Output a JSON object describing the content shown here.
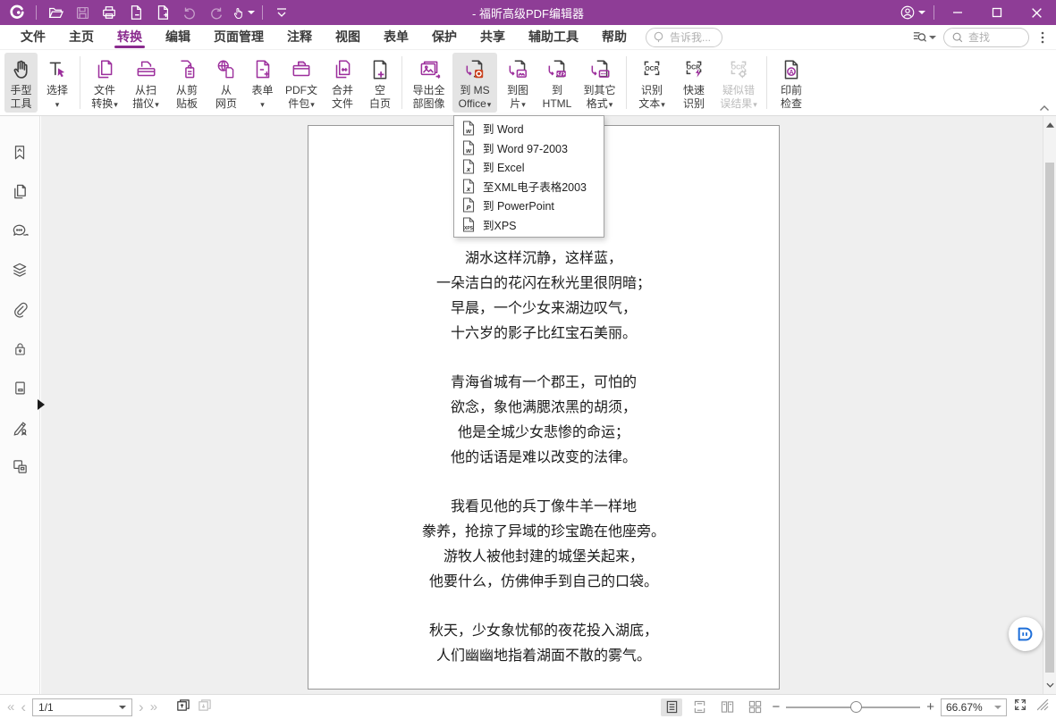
{
  "window": {
    "title": "- 福昕高级PDF编辑器"
  },
  "menu": {
    "tabs": [
      {
        "label": "文件"
      },
      {
        "label": "主页"
      },
      {
        "label": "转换"
      },
      {
        "label": "编辑"
      },
      {
        "label": "页面管理"
      },
      {
        "label": "注释"
      },
      {
        "label": "视图"
      },
      {
        "label": "表单"
      },
      {
        "label": "保护"
      },
      {
        "label": "共享"
      },
      {
        "label": "辅助工具"
      },
      {
        "label": "帮助"
      }
    ],
    "tell_me": "告诉我...",
    "find": "查找"
  },
  "ribbon": {
    "hand_tool": {
      "lines": [
        "手型",
        "工具"
      ]
    },
    "select": {
      "lines": [
        "选择"
      ]
    },
    "file_convert": {
      "lines": [
        "文件",
        "转换"
      ]
    },
    "from_scanner": {
      "lines": [
        "从扫",
        "描仪"
      ]
    },
    "from_clipboard": {
      "lines": [
        "从剪",
        "贴板"
      ]
    },
    "from_web": {
      "lines": [
        "从",
        "网页"
      ]
    },
    "form": {
      "lines": [
        "表单"
      ]
    },
    "pdf_portfolio": {
      "lines": [
        "PDF文",
        "件包"
      ]
    },
    "combine_files": {
      "lines": [
        "合并",
        "文件"
      ]
    },
    "blank_page": {
      "lines": [
        "空",
        "白页"
      ]
    },
    "export_all_images": {
      "lines": [
        "导出全",
        "部图像"
      ]
    },
    "to_ms_office": {
      "lines": [
        "到 MS",
        "Office"
      ]
    },
    "to_image": {
      "lines": [
        "到图",
        "片"
      ]
    },
    "to_html": {
      "lines": [
        "到",
        "HTML"
      ]
    },
    "to_other": {
      "lines": [
        "到其它",
        "格式"
      ]
    },
    "ocr_text": {
      "lines": [
        "识别",
        "文本"
      ]
    },
    "quick_ocr": {
      "lines": [
        "快速",
        "识别"
      ]
    },
    "suspect_results": {
      "lines": [
        "疑似错",
        "误结果"
      ]
    },
    "preflight": {
      "lines": [
        "印前",
        "检查"
      ]
    }
  },
  "dropdown": {
    "items": [
      {
        "label": "到 Word",
        "badge": "w"
      },
      {
        "label": "到 Word 97-2003",
        "badge": "w"
      },
      {
        "label": "到 Excel",
        "badge": "x"
      },
      {
        "label": "至XML电子表格2003",
        "badge": "x"
      },
      {
        "label": "到 PowerPoint",
        "badge": "P"
      },
      {
        "label": "到XPS",
        "badge": "XPS"
      }
    ]
  },
  "document": {
    "stanzas": [
      [
        "湖水这样沉静，这样蓝，",
        "一朵洁白的花闪在秋光里很阴暗；",
        "早晨，一个少女来湖边叹气，",
        "十六岁的影子比红宝石美丽。"
      ],
      [
        "青海省城有一个郡王，可怕的",
        "欲念，象他满腮浓黑的胡须，",
        "他是全城少女悲惨的命运；",
        "他的话语是难以改变的法律。"
      ],
      [
        "我看见他的兵丁像牛羊一样地",
        "豢养，抢掠了异域的珍宝跪在他座旁。",
        "游牧人被他封建的城堡关起来，",
        "他要什么，仿佛伸手到自己的口袋。"
      ],
      [
        "秋天，少女象忧郁的夜花投入湖底，",
        "人们幽幽地指着湖面不散的雾气。"
      ]
    ]
  },
  "status_bar": {
    "page_indicator": "1/1",
    "zoom_value": "66.67%"
  },
  "colors": {
    "titlebar_purple": "#8e3d96",
    "accent_purple": "#8a2b8e",
    "icon_purple": "#9c2f9c",
    "office_orange": "#c8421f",
    "ai_blue": "#1e6fd9"
  }
}
